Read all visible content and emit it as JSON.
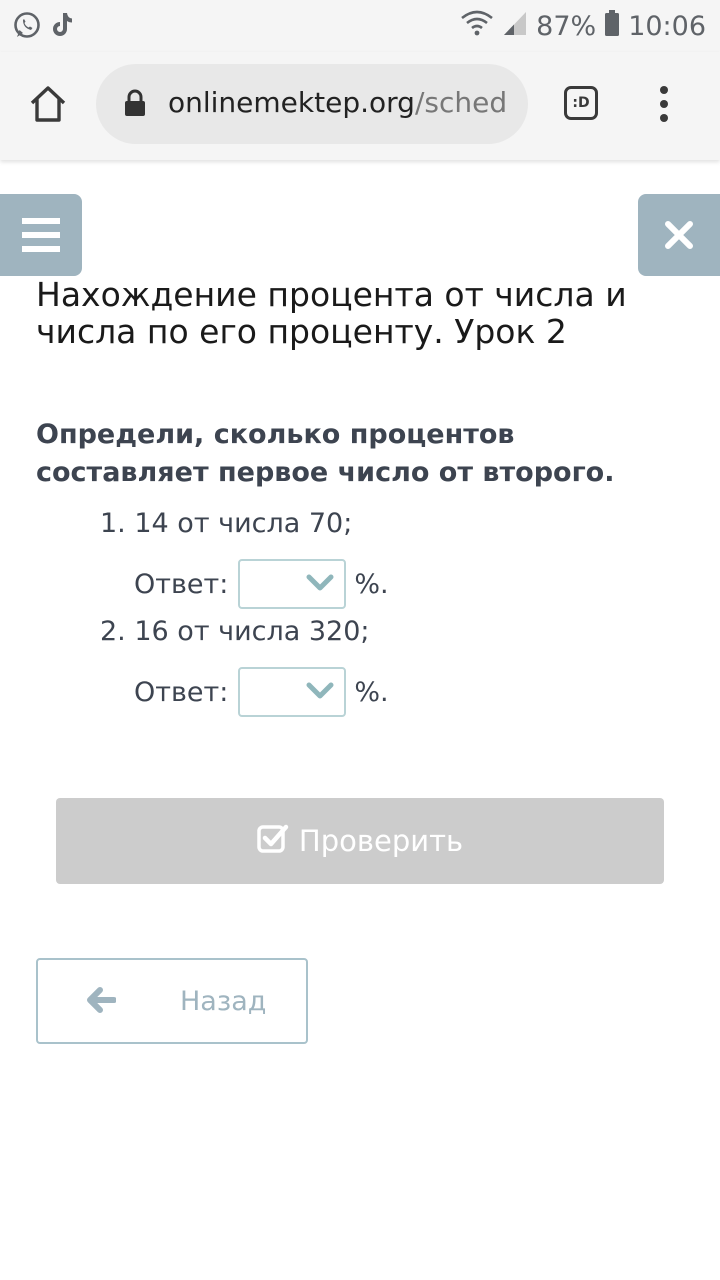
{
  "status_bar": {
    "battery": "87%",
    "time": "10:06"
  },
  "browser": {
    "url_host": "onlinemektep.org",
    "url_path": "/sched",
    "tab_badge": ":D"
  },
  "page": {
    "title": "Нахождение процента от числа и числа по его проценту. Урок 2",
    "instruction": "Определи, сколько процентов составляет первое число от второго.",
    "items": [
      {
        "number": "1.",
        "text": "14 от числа 70;",
        "answer_label": "Ответ:",
        "answer_value": "",
        "unit": "%."
      },
      {
        "number": "2.",
        "text": "16 от числа 320;",
        "answer_label": "Ответ:",
        "answer_value": "",
        "unit": "%."
      }
    ],
    "check_button": "Проверить",
    "back_button": "Назад"
  },
  "colors": {
    "accent": "#9fb4bf",
    "select_border": "#b9d3d6",
    "check_button_bg": "#cccccc",
    "text": "#3d4450"
  },
  "icons": [
    "whatsapp-icon",
    "tiktok-icon",
    "wifi-icon",
    "signal-icon",
    "battery-icon",
    "home-icon",
    "lock-icon",
    "tabs-icon",
    "more-vert-icon",
    "menu-icon",
    "close-icon",
    "chevron-down-icon",
    "checkbox-icon",
    "arrow-left-icon"
  ]
}
